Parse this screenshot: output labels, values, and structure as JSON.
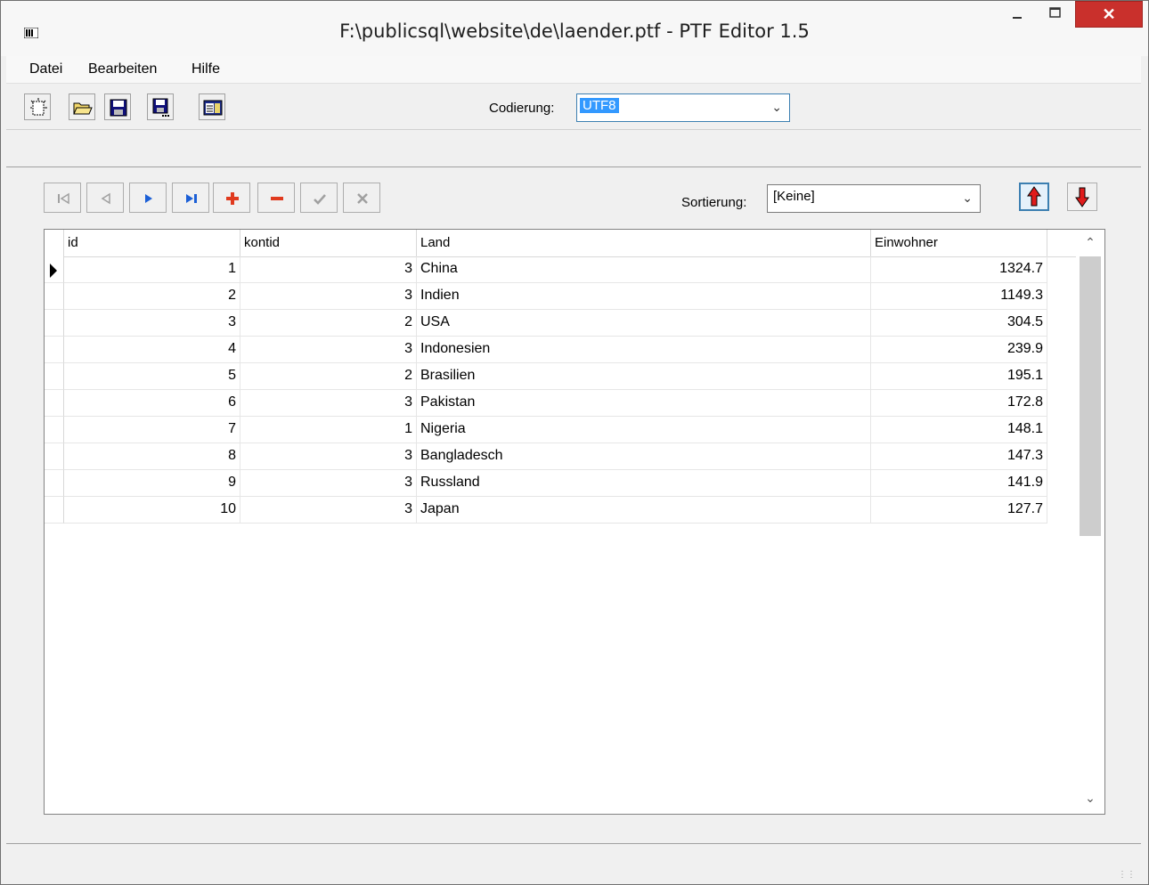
{
  "window": {
    "title": "F:\\publicsql\\website\\de\\laender.ptf - PTF Editor 1.5",
    "minimize_label": "–",
    "maximize_label": "□",
    "close_label": "✕"
  },
  "menu": {
    "items": [
      {
        "label": "Datei"
      },
      {
        "label": "Bearbeiten"
      },
      {
        "label": "Hilfe"
      }
    ]
  },
  "toolbar": {
    "buttons": [
      {
        "icon": "new-file-icon"
      },
      {
        "icon": "open-folder-icon"
      },
      {
        "icon": "save-icon"
      },
      {
        "icon": "save-as-icon"
      },
      {
        "icon": "properties-icon"
      }
    ],
    "codierung_label": "Codierung:",
    "codierung_value": "UTF8"
  },
  "navigator": {
    "buttons": [
      {
        "icon": "first-record-icon"
      },
      {
        "icon": "prior-record-icon"
      },
      {
        "icon": "next-record-icon"
      },
      {
        "icon": "last-record-icon"
      },
      {
        "icon": "insert-record-icon"
      },
      {
        "icon": "delete-record-icon"
      },
      {
        "icon": "post-record-icon"
      },
      {
        "icon": "cancel-record-icon"
      }
    ],
    "sort_label": "Sortierung:",
    "sort_value": "[Keine]",
    "sort_asc_icon": "arrow-up-icon",
    "sort_desc_icon": "arrow-down-icon"
  },
  "grid": {
    "columns": [
      "id",
      "kontid",
      "Land",
      "Einwohner"
    ],
    "rows": [
      [
        "1",
        "3",
        "China",
        "1324.7"
      ],
      [
        "2",
        "3",
        "Indien",
        "1149.3"
      ],
      [
        "3",
        "2",
        "USA",
        "304.5"
      ],
      [
        "4",
        "3",
        "Indonesien",
        "239.9"
      ],
      [
        "5",
        "2",
        "Brasilien",
        "195.1"
      ],
      [
        "6",
        "3",
        "Pakistan",
        "172.8"
      ],
      [
        "7",
        "1",
        "Nigeria",
        "148.1"
      ],
      [
        "8",
        "3",
        "Bangladesch",
        "147.3"
      ],
      [
        "9",
        "3",
        "Russland",
        "141.9"
      ],
      [
        "10",
        "3",
        "Japan",
        "127.7"
      ]
    ],
    "current_row": 1
  },
  "scrollbar": {
    "up_label": "⌃",
    "down_label": "⌄"
  },
  "colors": {
    "close_button": "#c9302c",
    "selection": "#3399ff",
    "accent_blue": "#1b5fd6",
    "accent_red": "#e03a1e"
  }
}
